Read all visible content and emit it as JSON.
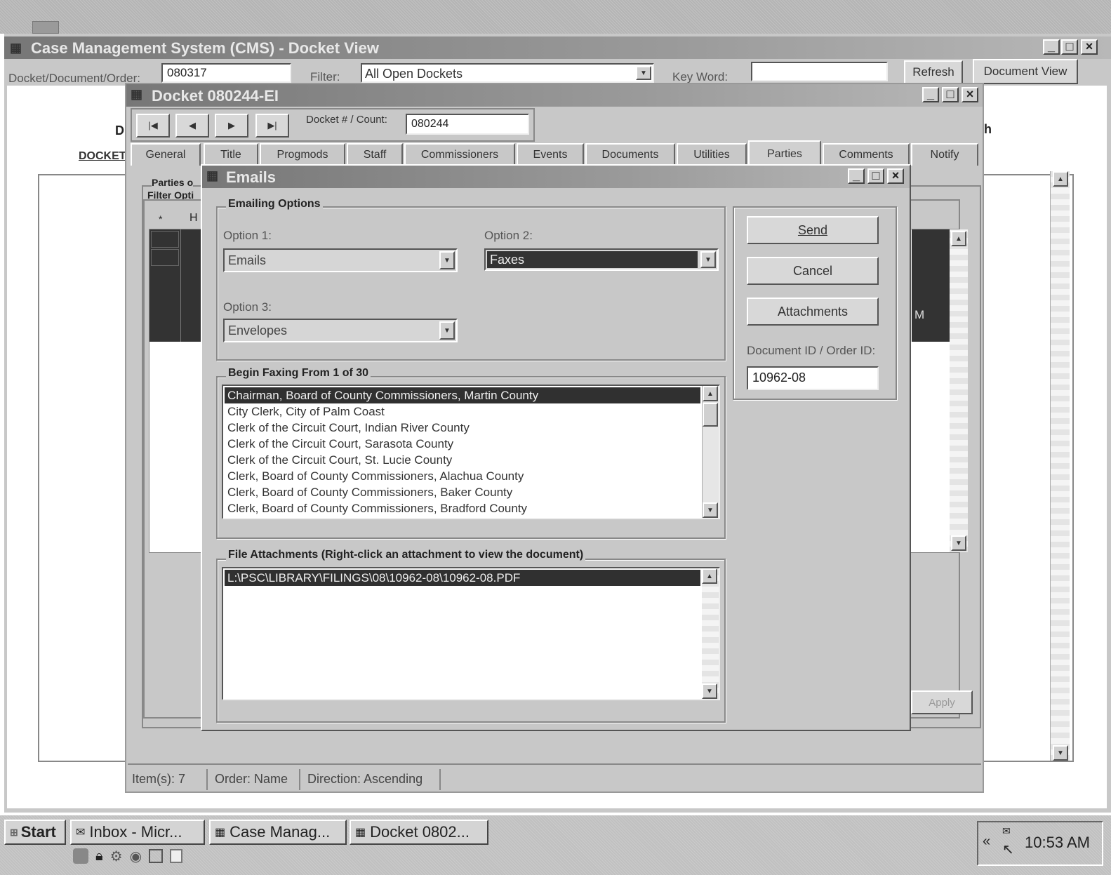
{
  "cms": {
    "title": "Case Management System (CMS) - Docket View",
    "docket_label": "Docket/Document/Order:",
    "docket_value": "080317",
    "filter_label": "Filter:",
    "filter_value": "All Open Dockets",
    "keyword_label": "Key Word:",
    "keyword_value": "",
    "refresh_label": "Refresh",
    "document_view_label": "Document View",
    "docket_link": "DOCKET",
    "partial_left": "D",
    "partial_right": "h"
  },
  "docket": {
    "title": "Docket 080244-EI",
    "count_label": "Docket # / Count:",
    "count_value": "080244",
    "tabs": [
      "General",
      "Title",
      "Progmods",
      "Staff",
      "Commissioners",
      "Events",
      "Documents",
      "Utilities",
      "Parties",
      "Comments",
      "Notify"
    ],
    "active_tab": "Parties",
    "parties_label": "Parties o",
    "filter_options_label": "Filter Opti",
    "grid_header_star": "*",
    "grid_header_h": "H",
    "right_cell_text": "M",
    "apply_label": "Apply",
    "status_items": "Item(s):  7",
    "status_order": "Order:  Name",
    "status_direction": "Direction:  Ascending"
  },
  "emails": {
    "title": "Emails",
    "emailing_options_label": "Emailing Options",
    "option1_label": "Option 1:",
    "option1_value": "Emails",
    "option2_label": "Option 2:",
    "option2_value": "Faxes",
    "option3_label": "Option 3:",
    "option3_value": "Envelopes",
    "send_label": "Send",
    "cancel_label": "Cancel",
    "attachments_label": "Attachments",
    "doc_id_label": "Document ID / Order ID:",
    "doc_id_value": "10962-08",
    "begin_label": "Begin Faxing From 1 of 30",
    "recipients": [
      "Chairman, Board of County Commissioners, Martin County",
      "City Clerk, City of Palm Coast",
      "Clerk of the Circuit Court, Indian River County",
      "Clerk of the Circuit Court, Sarasota County",
      "Clerk of the Circuit Court, St. Lucie County",
      "Clerk, Board of County Commissioners, Alachua County",
      "Clerk, Board of County Commissioners, Baker County",
      "Clerk, Board of County Commissioners, Bradford County"
    ],
    "attachments_group_label": "File Attachments (Right-click an attachment to view the document)",
    "attachment_files": [
      "L:\\PSC\\LIBRARY\\FILINGS\\08\\10962-08\\10962-08.PDF"
    ]
  },
  "taskbar": {
    "start_label": "Start",
    "buttons": [
      "Inbox - Micr...",
      "Case Manag...",
      "Docket 0802..."
    ],
    "clock": "10:53 AM"
  },
  "colors": {
    "selection": "#303030",
    "dialog_bg": "#c8c8c8",
    "titlebar": "#8a8a8a"
  }
}
